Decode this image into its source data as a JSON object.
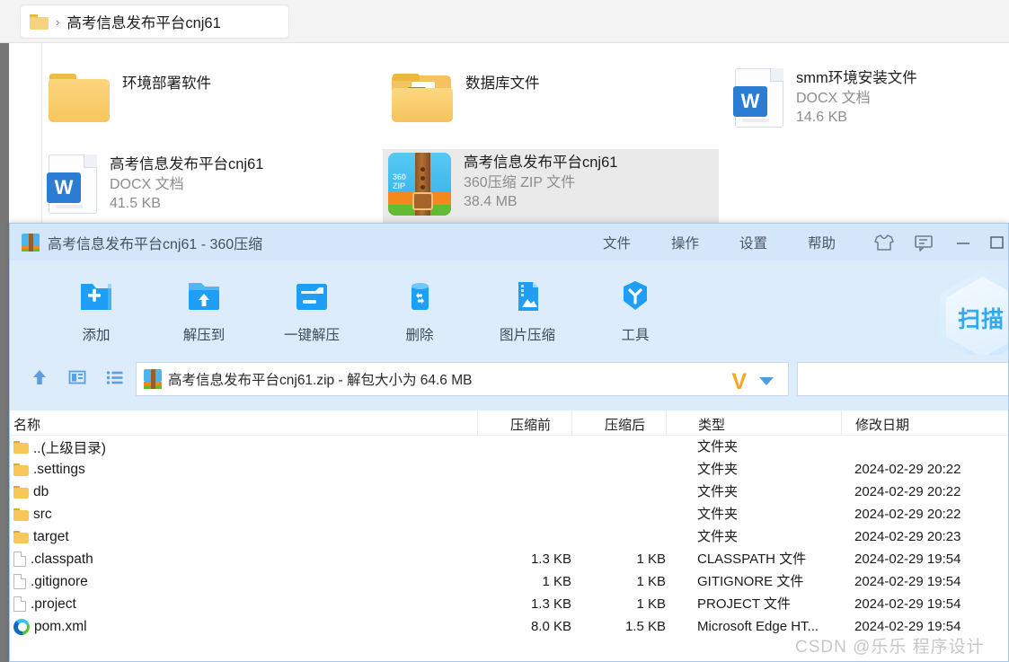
{
  "explorer": {
    "breadcrumb": {
      "folder_icon": "folder-icon",
      "separator": "›",
      "path": "高考信息发布平台cnj61"
    },
    "items": [
      {
        "name": "环境部署软件",
        "type": "",
        "size": "",
        "icon": "folder-icon",
        "selected": false
      },
      {
        "name": "数据库文件",
        "type": "",
        "size": "",
        "icon": "folder-database-icon",
        "selected": false
      },
      {
        "name": "smm环境安装文件",
        "type": "DOCX 文档",
        "size": "14.6 KB",
        "icon": "word-docx-icon",
        "selected": false
      },
      {
        "name": "高考信息发布平台cnj61",
        "type": "DOCX 文档",
        "size": "41.5 KB",
        "icon": "word-docx-icon",
        "selected": false
      },
      {
        "name": "高考信息发布平台cnj61",
        "type": "360压缩 ZIP 文件",
        "size": "38.4 MB",
        "icon": "zip-360-icon",
        "selected": true
      }
    ]
  },
  "zipwindow": {
    "title": "高考信息发布平台cnj61 - 360压缩",
    "title_icon": "zip-360-icon",
    "menu": [
      {
        "label": "文件",
        "name": "menu-file"
      },
      {
        "label": "操作",
        "name": "menu-action"
      },
      {
        "label": "设置",
        "name": "menu-settings"
      },
      {
        "label": "帮助",
        "name": "menu-help"
      }
    ],
    "window_buttons": [
      {
        "name": "skin-shirt-icon"
      },
      {
        "name": "feedback-message-icon"
      },
      {
        "name": "minimize-button"
      },
      {
        "name": "maximize-button"
      }
    ],
    "toolbar": [
      {
        "label": "添加",
        "name": "toolbar-add",
        "icon": "folder-plus-icon"
      },
      {
        "label": "解压到",
        "name": "toolbar-extract-to",
        "icon": "folder-up-arrow-icon"
      },
      {
        "label": "一键解压",
        "name": "toolbar-one-click-extract",
        "icon": "folder-extract-icon"
      },
      {
        "label": "删除",
        "name": "toolbar-delete",
        "icon": "recycle-bin-icon"
      },
      {
        "label": "图片压缩",
        "name": "toolbar-image-compress",
        "icon": "image-compress-icon"
      },
      {
        "label": "工具",
        "name": "toolbar-tools",
        "icon": "tools-shield-icon"
      }
    ],
    "scan_badge": {
      "label": "扫描",
      "name": "scan-shield-badge"
    },
    "address_bar": {
      "nav_icons": [
        {
          "name": "up-level-icon"
        },
        {
          "name": "panel-layout-icon"
        },
        {
          "name": "list-view-icon"
        }
      ],
      "archive_icon": "zip-360-icon",
      "value": "高考信息发布平台cnj61.zip - 解包大小为 64.6 MB",
      "v_icon": "V",
      "dropdown_icon": "chevron-down-icon"
    },
    "filelist": {
      "columns": [
        "名称",
        "压缩前",
        "压缩后",
        "类型",
        "修改日期"
      ],
      "rows": [
        {
          "name": "..(上级目录)",
          "pre": "",
          "post": "",
          "type": "文件夹",
          "date": "",
          "icon": "folder-icon"
        },
        {
          "name": ".settings",
          "pre": "",
          "post": "",
          "type": "文件夹",
          "date": "2024-02-29 20:22",
          "icon": "folder-icon"
        },
        {
          "name": "db",
          "pre": "",
          "post": "",
          "type": "文件夹",
          "date": "2024-02-29 20:22",
          "icon": "folder-icon"
        },
        {
          "name": "src",
          "pre": "",
          "post": "",
          "type": "文件夹",
          "date": "2024-02-29 20:22",
          "icon": "folder-icon"
        },
        {
          "name": "target",
          "pre": "",
          "post": "",
          "type": "文件夹",
          "date": "2024-02-29 20:23",
          "icon": "folder-icon"
        },
        {
          "name": ".classpath",
          "pre": "1.3 KB",
          "post": "1 KB",
          "type": "CLASSPATH 文件",
          "date": "2024-02-29 19:54",
          "icon": "file-icon"
        },
        {
          "name": ".gitignore",
          "pre": "1 KB",
          "post": "1 KB",
          "type": "GITIGNORE 文件",
          "date": "2024-02-29 19:54",
          "icon": "file-icon"
        },
        {
          "name": ".project",
          "pre": "1.3 KB",
          "post": "1 KB",
          "type": "PROJECT 文件",
          "date": "2024-02-29 19:54",
          "icon": "file-icon"
        },
        {
          "name": "pom.xml",
          "pre": "8.0 KB",
          "post": "1.5 KB",
          "type": "Microsoft Edge HT...",
          "date": "2024-02-29 19:54",
          "icon": "edge-browser-icon"
        }
      ]
    }
  },
  "watermark": {
    "text": "CSDN @乐乐 程序设计"
  },
  "colors": {
    "zip_window_bg": "#ddecfb",
    "zip_titlebar": "#d4e7fa",
    "accent_blue": "#2b8ef0",
    "folder_yellow": "#f7c758",
    "orange": "#f5871f",
    "green": "#63bb34",
    "scan_blue": "#35a9ee"
  }
}
